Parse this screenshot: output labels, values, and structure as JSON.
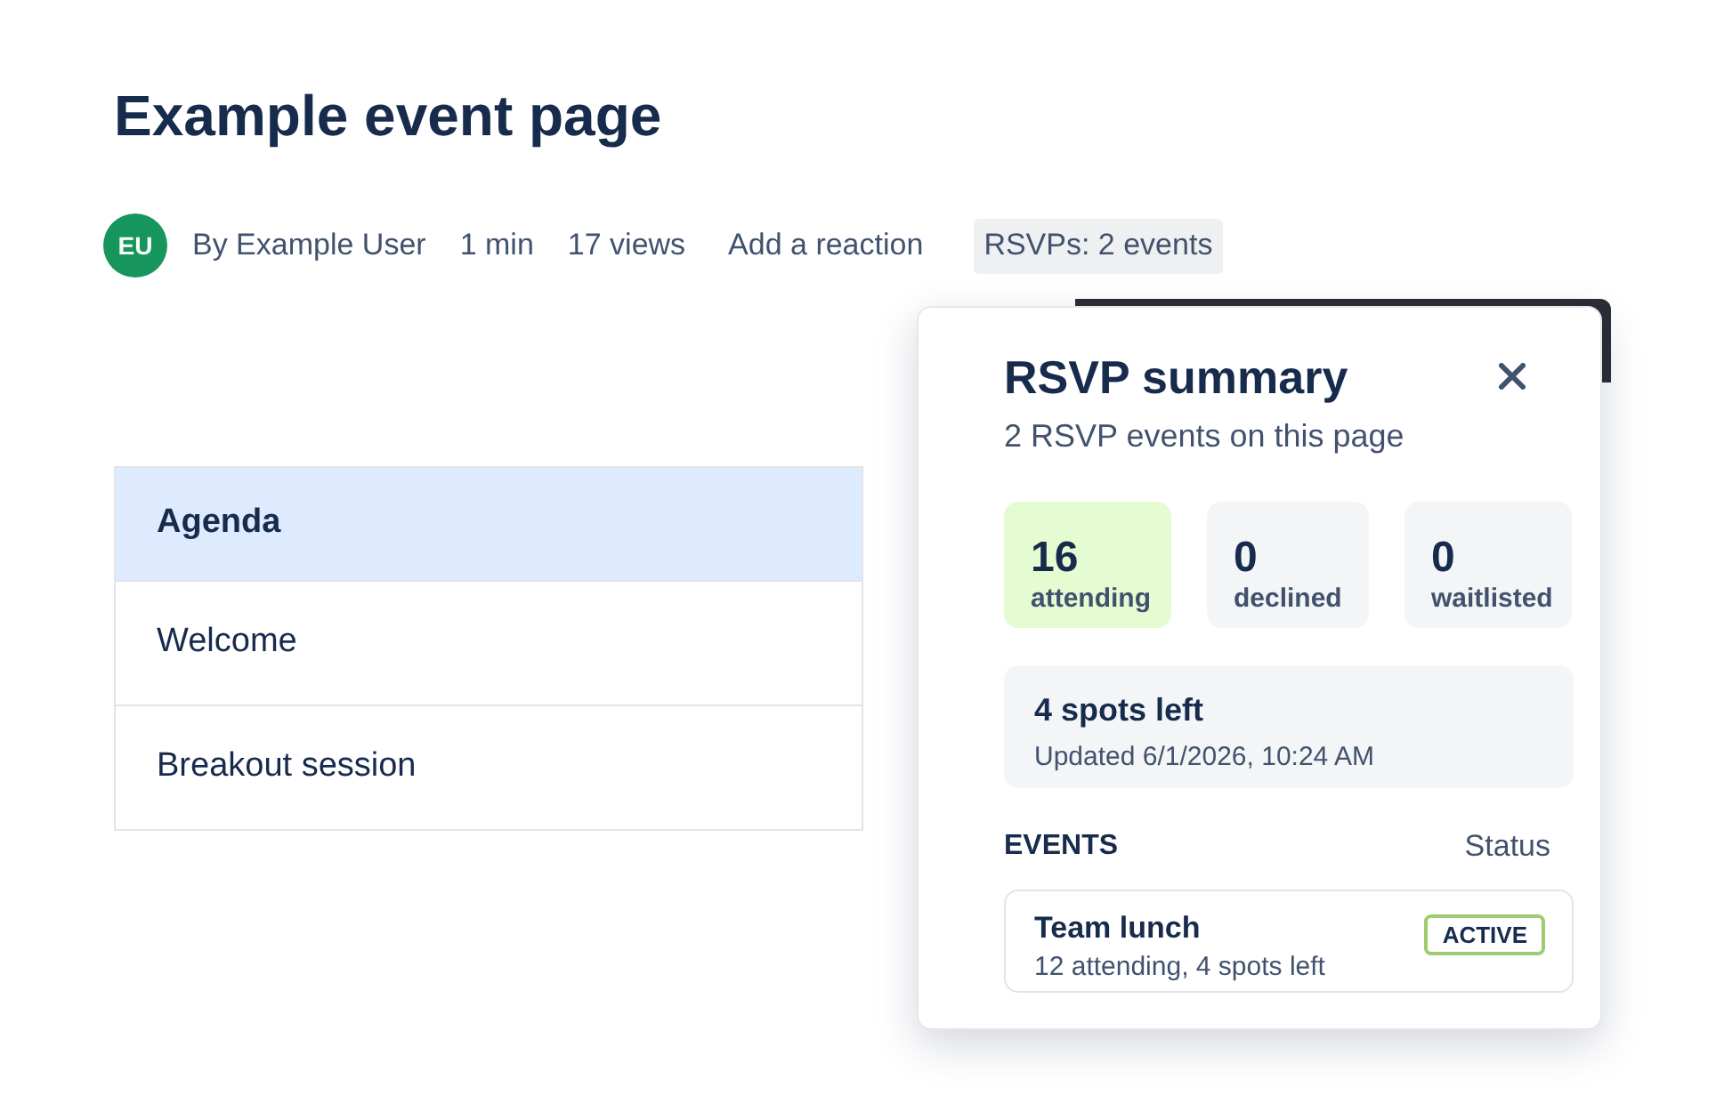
{
  "page": {
    "title": "Example event page"
  },
  "byline": {
    "avatar": "EU",
    "author": "By Example User",
    "meta": [
      "1 min",
      "17 views"
    ],
    "reaction_link": "Add a reaction",
    "rsvp_button": "RSVPs: 2 events"
  },
  "agenda_table": {
    "columns": [
      "Agenda"
    ],
    "rows": [
      [
        "Welcome"
      ],
      [
        "Breakout session"
      ]
    ]
  },
  "rsvp_popover": {
    "title": "RSVP summary",
    "subtitle": "2 RSVP events on this page",
    "stats": [
      {
        "value": "16",
        "label": "attending",
        "highlighted": true
      },
      {
        "value": "0",
        "label": "declined",
        "highlighted": false
      },
      {
        "value": "0",
        "label": "waitlisted",
        "highlighted": false
      }
    ],
    "capacity": {
      "title": "4 spots left",
      "updated": "Updated 6/1/2026, 10:24 AM"
    },
    "events_header": {
      "label": "EVENTS",
      "status_label": "Status"
    },
    "events": [
      {
        "name": "Team lunch",
        "detail": "12 attending, 4 spots left",
        "status": "ACTIVE"
      }
    ]
  }
}
